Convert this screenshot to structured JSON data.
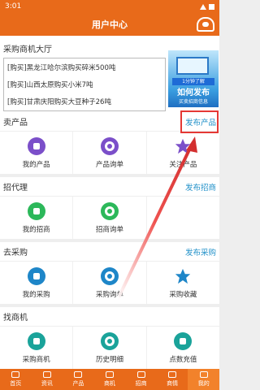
{
  "status_bar": {
    "time": "3:01"
  },
  "header": {
    "title": "用户中心",
    "user_icon": "user-service-icon"
  },
  "hall": {
    "title": "采购商机大厅",
    "items": [
      "[购买]黑龙江哈尔滨购买碎米500吨",
      "[购买]山西太原购买小米7吨",
      "[购买]甘肃庆阳购买大豆种子26吨"
    ],
    "banner": {
      "line1": "1分钟了解",
      "line2": "如何发布",
      "line3": "买卖招商信息"
    }
  },
  "sections": [
    {
      "title": "卖产品",
      "link": "发布产品",
      "items": [
        {
          "label": "我的产品",
          "icon": "box-icon",
          "color": "#7b4fc9"
        },
        {
          "label": "产品询单",
          "icon": "target-icon",
          "color": "#7b4fc9"
        },
        {
          "label": "关注产品",
          "icon": "star-icon",
          "color": "#7b4fc9"
        }
      ]
    },
    {
      "title": "招代理",
      "link": "发布招商",
      "items": [
        {
          "label": "我的招商",
          "icon": "grid-icon",
          "color": "#2cb85a"
        },
        {
          "label": "招商询单",
          "icon": "target-icon",
          "color": "#2cb85a"
        }
      ]
    },
    {
      "title": "去采购",
      "link": "发布采购",
      "items": [
        {
          "label": "我的采购",
          "icon": "box-icon",
          "color": "#1e86c8"
        },
        {
          "label": "采购询单",
          "icon": "target-icon",
          "color": "#1e86c8"
        },
        {
          "label": "采购收藏",
          "icon": "star-icon",
          "color": "#1e86c8"
        }
      ]
    },
    {
      "title": "找商机",
      "items": [
        {
          "label": "采购商机",
          "icon": "server-icon",
          "color": "#1aa39a"
        },
        {
          "label": "历史明细",
          "icon": "pie-icon",
          "color": "#1aa39a"
        },
        {
          "label": "点数充值",
          "icon": "coins-icon",
          "color": "#1aa39a"
        }
      ]
    }
  ],
  "tabbar": {
    "items": [
      {
        "label": "首页",
        "icon": "home-icon"
      },
      {
        "label": "资讯",
        "icon": "news-icon"
      },
      {
        "label": "产品",
        "icon": "product-icon"
      },
      {
        "label": "商机",
        "icon": "opportunity-icon"
      },
      {
        "label": "招商",
        "icon": "merchant-icon"
      },
      {
        "label": "商情",
        "icon": "market-icon"
      },
      {
        "label": "我的",
        "icon": "profile-icon"
      }
    ],
    "active_index": 6
  },
  "colors": {
    "brand": "#e86a1a",
    "link": "#1e8fc8",
    "highlight": "#e53935"
  }
}
